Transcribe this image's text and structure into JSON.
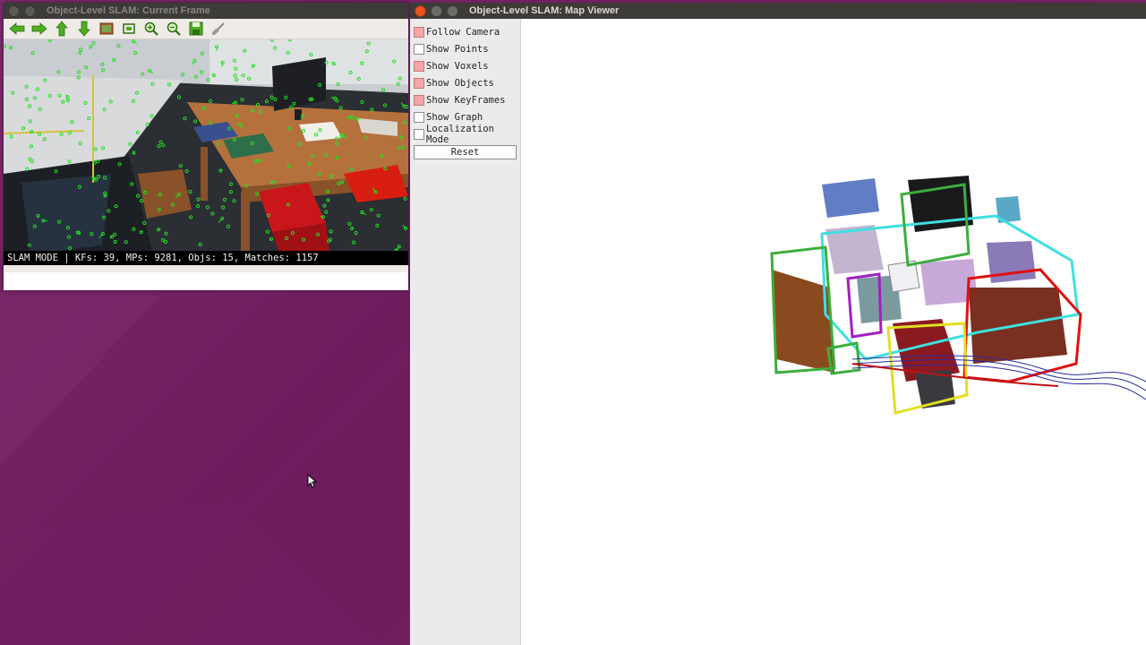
{
  "desktop": {
    "background": "#75236a"
  },
  "frame_window": {
    "title": "Object-Level SLAM: Current Frame",
    "toolbar": [
      {
        "icon": "arrow-left-icon"
      },
      {
        "icon": "arrow-right-icon"
      },
      {
        "icon": "arrow-up-icon"
      },
      {
        "icon": "arrow-down-icon"
      },
      {
        "icon": "image-icon"
      },
      {
        "icon": "zoom-fit-icon"
      },
      {
        "icon": "zoom-in-icon"
      },
      {
        "icon": "zoom-out-icon"
      },
      {
        "icon": "save-icon"
      },
      {
        "icon": "properties-brush-icon"
      }
    ],
    "status": "SLAM MODE |  KFs: 39, MPs: 9281, Objs: 15, Matches: 1157"
  },
  "map_window": {
    "title": "Object-Level SLAM: Map Viewer",
    "options": [
      {
        "label": "Follow Camera",
        "checked": true
      },
      {
        "label": "Show Points",
        "checked": false
      },
      {
        "label": "Show Voxels",
        "checked": true
      },
      {
        "label": "Show Objects",
        "checked": true
      },
      {
        "label": "Show KeyFrames",
        "checked": true
      },
      {
        "label": "Show Graph",
        "checked": false
      },
      {
        "label": "Localization Mode",
        "checked": false
      }
    ],
    "reset_label": "Reset"
  },
  "colors": {
    "title_bar": "#3c3b37",
    "close_button": "#e95420",
    "feature_points": "#22e022",
    "checkbox_on": "#f4a6a6",
    "box_green": "#3cae3c",
    "box_cyan": "#3ee0e0",
    "box_red": "#e01010",
    "box_yellow": "#e0e020",
    "box_purple": "#a020c0",
    "trajectory": "#2a2aa0"
  }
}
